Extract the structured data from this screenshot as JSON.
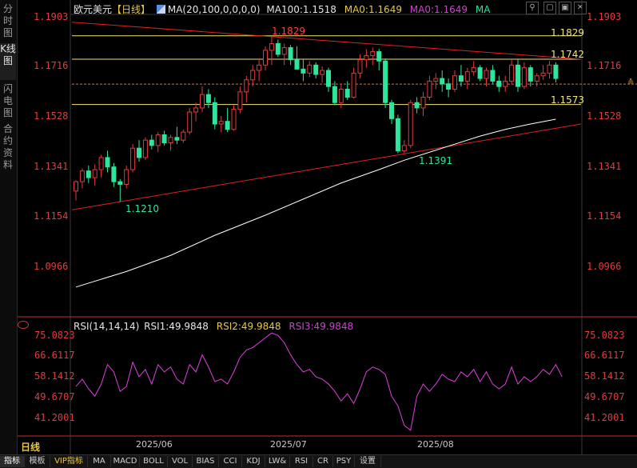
{
  "sidebar": {
    "tabs": [
      {
        "label": "分时图",
        "active": false
      },
      {
        "label": "K线图",
        "active": true
      },
      {
        "label": "闪电图",
        "active": false
      },
      {
        "label": "合约资料",
        "active": false
      }
    ]
  },
  "main_chart": {
    "symbol": "欧元美元",
    "period_tag": "【日线】",
    "ma_params": "MA(20,100,0,0,0,0)",
    "ma100": "MA100:1.1518",
    "ma0_a": "MA0:1.1649",
    "ma0_b": "MA0:1.1649",
    "ma_short": "MA",
    "price_ticks": [
      "1.1903",
      "1.1716",
      "1.1528",
      "1.1341",
      "1.1154",
      "1.0966"
    ],
    "annotations": {
      "high_label": "1.1829",
      "level_1829": "1.1829",
      "level_1742": "1.1742",
      "level_1573": "1.1573",
      "low_label_a": "1.1391",
      "low_label_b": "1.1210"
    }
  },
  "rsi_panel": {
    "params": "RSI(14,14,14)",
    "rsi1": "RSI1:49.9848",
    "rsi2": "RSI2:49.9848",
    "rsi3": "RSI3:49.9848",
    "ticks": [
      "75.0823",
      "66.6117",
      "58.1412",
      "49.6707",
      "41.2001"
    ]
  },
  "time_axis": {
    "period_label": "日线",
    "months": [
      "2025/06",
      "2025/07",
      "2025/08"
    ]
  },
  "bottom_tabs": [
    "指标",
    "模板",
    "VIP指标",
    "MA",
    "MACD",
    "BOLL",
    "VOL",
    "BIAS",
    "CCI",
    "KDJ",
    "LW&",
    "RSI",
    "CR",
    "PSY",
    "设置"
  ],
  "colors": {
    "up": "#e03c3c",
    "down": "#2ee59d",
    "ma_line": "#ffffff",
    "trend_line": "#e02020",
    "level_line": "#f2e27a",
    "rsi_line": "#e040e0",
    "price_text": "#e03c3c",
    "ma0_text": "#e8c840",
    "rsi3_text": "#d040d0"
  },
  "chart_data": {
    "type": "candlestick",
    "ylim": [
      1.0875,
      1.1935
    ],
    "candles": [
      {
        "o": 1.125,
        "h": 1.129,
        "l": 1.1215,
        "c": 1.1285
      },
      {
        "o": 1.1285,
        "h": 1.1335,
        "l": 1.126,
        "c": 1.1325
      },
      {
        "o": 1.1325,
        "h": 1.1345,
        "l": 1.128,
        "c": 1.13
      },
      {
        "o": 1.13,
        "h": 1.135,
        "l": 1.127,
        "c": 1.133
      },
      {
        "o": 1.133,
        "h": 1.1385,
        "l": 1.13,
        "c": 1.1375
      },
      {
        "o": 1.1375,
        "h": 1.14,
        "l": 1.132,
        "c": 1.134
      },
      {
        "o": 1.134,
        "h": 1.1355,
        "l": 1.1265,
        "c": 1.1285
      },
      {
        "o": 1.1285,
        "h": 1.1295,
        "l": 1.121,
        "c": 1.1275
      },
      {
        "o": 1.1275,
        "h": 1.1345,
        "l": 1.126,
        "c": 1.133
      },
      {
        "o": 1.133,
        "h": 1.1425,
        "l": 1.132,
        "c": 1.141
      },
      {
        "o": 1.141,
        "h": 1.144,
        "l": 1.136,
        "c": 1.1375
      },
      {
        "o": 1.1375,
        "h": 1.145,
        "l": 1.1365,
        "c": 1.144
      },
      {
        "o": 1.144,
        "h": 1.146,
        "l": 1.1405,
        "c": 1.142
      },
      {
        "o": 1.142,
        "h": 1.147,
        "l": 1.1395,
        "c": 1.146
      },
      {
        "o": 1.146,
        "h": 1.1475,
        "l": 1.142,
        "c": 1.143
      },
      {
        "o": 1.143,
        "h": 1.146,
        "l": 1.14,
        "c": 1.145
      },
      {
        "o": 1.145,
        "h": 1.149,
        "l": 1.1425,
        "c": 1.144
      },
      {
        "o": 1.144,
        "h": 1.148,
        "l": 1.143,
        "c": 1.147
      },
      {
        "o": 1.147,
        "h": 1.156,
        "l": 1.146,
        "c": 1.1545
      },
      {
        "o": 1.1545,
        "h": 1.158,
        "l": 1.151,
        "c": 1.156
      },
      {
        "o": 1.156,
        "h": 1.164,
        "l": 1.1545,
        "c": 1.161
      },
      {
        "o": 1.161,
        "h": 1.163,
        "l": 1.156,
        "c": 1.158
      },
      {
        "o": 1.158,
        "h": 1.16,
        "l": 1.148,
        "c": 1.15
      },
      {
        "o": 1.15,
        "h": 1.153,
        "l": 1.147,
        "c": 1.151
      },
      {
        "o": 1.151,
        "h": 1.156,
        "l": 1.147,
        "c": 1.148
      },
      {
        "o": 1.148,
        "h": 1.157,
        "l": 1.1475,
        "c": 1.1555
      },
      {
        "o": 1.1555,
        "h": 1.164,
        "l": 1.154,
        "c": 1.162
      },
      {
        "o": 1.162,
        "h": 1.168,
        "l": 1.158,
        "c": 1.1665
      },
      {
        "o": 1.1665,
        "h": 1.172,
        "l": 1.164,
        "c": 1.17
      },
      {
        "o": 1.17,
        "h": 1.1745,
        "l": 1.166,
        "c": 1.172
      },
      {
        "o": 1.172,
        "h": 1.179,
        "l": 1.17,
        "c": 1.1775
      },
      {
        "o": 1.1775,
        "h": 1.1829,
        "l": 1.172,
        "c": 1.18
      },
      {
        "o": 1.18,
        "h": 1.1815,
        "l": 1.175,
        "c": 1.176
      },
      {
        "o": 1.176,
        "h": 1.18,
        "l": 1.172,
        "c": 1.1785
      },
      {
        "o": 1.1785,
        "h": 1.1795,
        "l": 1.172,
        "c": 1.174
      },
      {
        "o": 1.174,
        "h": 1.179,
        "l": 1.1705,
        "c": 1.1705
      },
      {
        "o": 1.1705,
        "h": 1.174,
        "l": 1.166,
        "c": 1.169
      },
      {
        "o": 1.169,
        "h": 1.1735,
        "l": 1.1675,
        "c": 1.172
      },
      {
        "o": 1.172,
        "h": 1.173,
        "l": 1.167,
        "c": 1.1685
      },
      {
        "o": 1.1685,
        "h": 1.1715,
        "l": 1.1655,
        "c": 1.17
      },
      {
        "o": 1.17,
        "h": 1.171,
        "l": 1.162,
        "c": 1.164
      },
      {
        "o": 1.164,
        "h": 1.166,
        "l": 1.157,
        "c": 1.158
      },
      {
        "o": 1.158,
        "h": 1.165,
        "l": 1.156,
        "c": 1.163
      },
      {
        "o": 1.163,
        "h": 1.166,
        "l": 1.159,
        "c": 1.16
      },
      {
        "o": 1.16,
        "h": 1.171,
        "l": 1.1595,
        "c": 1.169
      },
      {
        "o": 1.169,
        "h": 1.176,
        "l": 1.167,
        "c": 1.174
      },
      {
        "o": 1.174,
        "h": 1.178,
        "l": 1.171,
        "c": 1.1755
      },
      {
        "o": 1.1755,
        "h": 1.1785,
        "l": 1.172,
        "c": 1.177
      },
      {
        "o": 1.177,
        "h": 1.178,
        "l": 1.17,
        "c": 1.1735
      },
      {
        "o": 1.1735,
        "h": 1.1745,
        "l": 1.156,
        "c": 1.158
      },
      {
        "o": 1.158,
        "h": 1.159,
        "l": 1.15,
        "c": 1.152
      },
      {
        "o": 1.152,
        "h": 1.1535,
        "l": 1.1391,
        "c": 1.14
      },
      {
        "o": 1.14,
        "h": 1.144,
        "l": 1.1391,
        "c": 1.142
      },
      {
        "o": 1.142,
        "h": 1.159,
        "l": 1.141,
        "c": 1.158
      },
      {
        "o": 1.158,
        "h": 1.16,
        "l": 1.154,
        "c": 1.156
      },
      {
        "o": 1.156,
        "h": 1.162,
        "l": 1.153,
        "c": 1.16
      },
      {
        "o": 1.16,
        "h": 1.168,
        "l": 1.159,
        "c": 1.166
      },
      {
        "o": 1.166,
        "h": 1.169,
        "l": 1.163,
        "c": 1.167
      },
      {
        "o": 1.167,
        "h": 1.17,
        "l": 1.162,
        "c": 1.165
      },
      {
        "o": 1.165,
        "h": 1.167,
        "l": 1.16,
        "c": 1.163
      },
      {
        "o": 1.163,
        "h": 1.17,
        "l": 1.162,
        "c": 1.168
      },
      {
        "o": 1.168,
        "h": 1.172,
        "l": 1.164,
        "c": 1.166
      },
      {
        "o": 1.166,
        "h": 1.171,
        "l": 1.163,
        "c": 1.1695
      },
      {
        "o": 1.1695,
        "h": 1.1735,
        "l": 1.168,
        "c": 1.171
      },
      {
        "o": 1.171,
        "h": 1.172,
        "l": 1.166,
        "c": 1.167
      },
      {
        "o": 1.167,
        "h": 1.171,
        "l": 1.164,
        "c": 1.17
      },
      {
        "o": 1.17,
        "h": 1.172,
        "l": 1.165,
        "c": 1.166
      },
      {
        "o": 1.166,
        "h": 1.168,
        "l": 1.162,
        "c": 1.164
      },
      {
        "o": 1.164,
        "h": 1.168,
        "l": 1.162,
        "c": 1.166
      },
      {
        "o": 1.166,
        "h": 1.1742,
        "l": 1.165,
        "c": 1.172
      },
      {
        "o": 1.172,
        "h": 1.1742,
        "l": 1.162,
        "c": 1.164
      },
      {
        "o": 1.164,
        "h": 1.173,
        "l": 1.163,
        "c": 1.171
      },
      {
        "o": 1.171,
        "h": 1.172,
        "l": 1.164,
        "c": 1.166
      },
      {
        "o": 1.166,
        "h": 1.169,
        "l": 1.164,
        "c": 1.168
      },
      {
        "o": 1.168,
        "h": 1.172,
        "l": 1.1665,
        "c": 1.169
      },
      {
        "o": 1.169,
        "h": 1.1735,
        "l": 1.167,
        "c": 1.172
      },
      {
        "o": 1.172,
        "h": 1.173,
        "l": 1.1655,
        "c": 1.167
      }
    ],
    "ma100": [
      [
        0,
        1.0892
      ],
      [
        8,
        1.095
      ],
      [
        15,
        1.101
      ],
      [
        22,
        1.1085
      ],
      [
        30,
        1.116
      ],
      [
        36,
        1.122
      ],
      [
        42,
        1.128
      ],
      [
        48,
        1.133
      ],
      [
        52,
        1.1365
      ],
      [
        56,
        1.1395
      ],
      [
        60,
        1.1425
      ],
      [
        64,
        1.1455
      ],
      [
        68,
        1.148
      ],
      [
        72,
        1.15
      ],
      [
        76,
        1.1518
      ]
    ],
    "resistance_trend": [
      [
        0,
        1.188
      ],
      [
        78,
        1.1742
      ]
    ],
    "support_trend": [
      [
        0,
        1.118
      ],
      [
        78,
        1.15
      ]
    ],
    "levels": [
      1.1829,
      1.1742,
      1.1573
    ],
    "current_price": 1.1649,
    "rsi": [
      54,
      57,
      53,
      50,
      55,
      63,
      60,
      52,
      54,
      64,
      58,
      61,
      55,
      63,
      60,
      62,
      57,
      55,
      63,
      60,
      67,
      62,
      56,
      57,
      55,
      60,
      66,
      69,
      70,
      72,
      74,
      76,
      75,
      72,
      67,
      63,
      60,
      61,
      58,
      57,
      55,
      52,
      48,
      51,
      47,
      53,
      60,
      62,
      61,
      59,
      50,
      46,
      38,
      36,
      50,
      55,
      52,
      55,
      59,
      57,
      56,
      60,
      58,
      61,
      56,
      60,
      55,
      53,
      55,
      62,
      55,
      58,
      56,
      58,
      61,
      59,
      63,
      58
    ]
  }
}
